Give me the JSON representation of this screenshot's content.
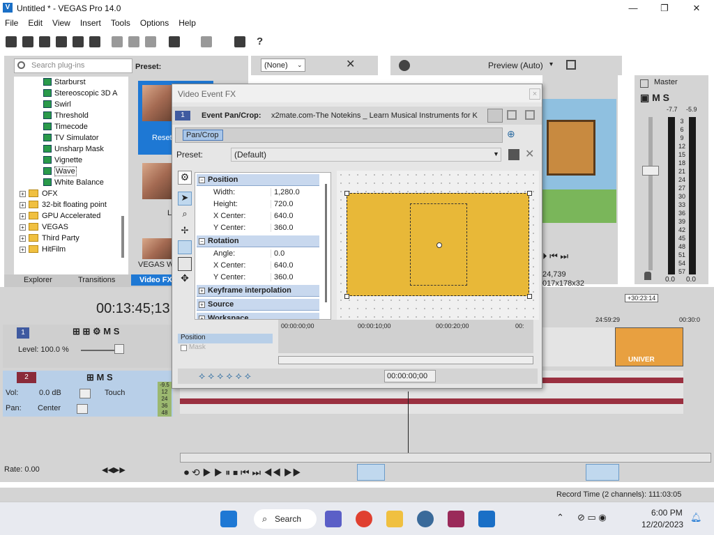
{
  "window": {
    "title": "Untitled * - VEGAS Pro 14.0",
    "logo": "V"
  },
  "menu": [
    "File",
    "Edit",
    "View",
    "Insert",
    "Tools",
    "Options",
    "Help"
  ],
  "plugins": {
    "search_placeholder": "Search plug-ins",
    "fx_items": [
      "Starburst",
      "Stereoscopic 3D A",
      "Swirl",
      "Threshold",
      "Timecode",
      "TV Simulator",
      "Unsharp Mask",
      "Vignette",
      "Wave",
      "White Balance"
    ],
    "selected": "Wave",
    "folders": [
      "OFX",
      "32-bit floating point",
      "GPU Accelerated",
      "VEGAS",
      "Third Party",
      "HitFilm"
    ],
    "preset_label": "Preset:",
    "presets": [
      "Reset",
      "La",
      "VEGAS Wav"
    ],
    "tabs": [
      "Explorer",
      "Transitions",
      "Video FX"
    ]
  },
  "preview": {
    "combo": "(None)",
    "quality": "Preview (Auto)",
    "info1": "24,739",
    "info2": "017x178x32"
  },
  "master": {
    "label": "Master",
    "levels": [
      "-7.7",
      "-5.9"
    ],
    "scale": [
      "3",
      "6",
      "9",
      "12",
      "15",
      "18",
      "21",
      "24",
      "27",
      "30",
      "33",
      "36",
      "39",
      "42",
      "45",
      "48",
      "51",
      "54",
      "57"
    ],
    "out": [
      "0.0",
      "0.0"
    ]
  },
  "dialog": {
    "title": "Video Event FX",
    "close": "×",
    "track_num": "1",
    "fx_label": "Event Pan/Crop:",
    "fx_source": "x2mate.com-The Notekins _ Learn Musical Instruments for K",
    "chain_pill": "Pan/Crop",
    "preset_label": "Preset:",
    "preset_value": "(Default)",
    "sections": {
      "position": {
        "label": "Position",
        "toggle": "−",
        "props": [
          {
            "k": "Width:",
            "v": "1,280.0"
          },
          {
            "k": "Height:",
            "v": "720.0"
          },
          {
            "k": "X Center:",
            "v": "640.0"
          },
          {
            "k": "Y Center:",
            "v": "360.0"
          }
        ]
      },
      "rotation": {
        "label": "Rotation",
        "toggle": "−",
        "props": [
          {
            "k": "Angle:",
            "v": "0.0"
          },
          {
            "k": "X Center:",
            "v": "640.0"
          },
          {
            "k": "Y Center:",
            "v": "360.0"
          }
        ]
      },
      "keyframe": {
        "label": "Keyframe interpolation",
        "toggle": "+"
      },
      "source": {
        "label": "Source",
        "toggle": "+"
      },
      "workspace": {
        "label": "Workspace",
        "toggle": "+"
      }
    },
    "kf_rows": [
      "Position",
      "Mask"
    ],
    "kf_times": [
      "00:00:00;00",
      "00:00:10;00",
      "00:00:20;00",
      "00:"
    ],
    "kf_time_display": "00:00:00;00"
  },
  "timeline": {
    "timecode": "00:13:45;13",
    "marker": "+30:23:14",
    "ruler": [
      "24:59:29",
      "00:30:0"
    ],
    "track1": {
      "num": "1",
      "level_label": "Level: 100.0 %"
    },
    "track2": {
      "num": "2",
      "vol_label": "Vol:",
      "vol_value": "0.0 dB",
      "pan_label": "Pan:",
      "pan_value": "Center",
      "touch": "Touch",
      "meter": [
        "-9.5",
        "12",
        "24",
        "36",
        "48"
      ]
    },
    "clip_text": "UNIVER",
    "rate": "Rate: 0.00"
  },
  "status": {
    "record_time": "Record Time (2 channels): 111:03:05"
  },
  "taskbar": {
    "search": "Search",
    "time": "6:00 PM",
    "date": "12/20/2023"
  },
  "colors": {
    "accent": "#1a6fc6",
    "selection": "#1e78d4",
    "frame": "#e8b838",
    "audio": "#9a3040"
  }
}
